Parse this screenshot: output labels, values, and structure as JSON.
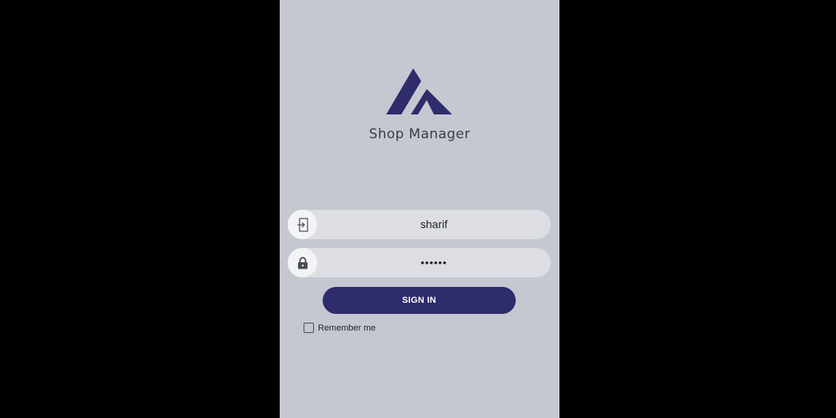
{
  "app": {
    "title": "Shop Manager",
    "logo_icon": "mountain-logo-icon",
    "brand_color": "#2e2c6b",
    "background_color": "#c5c8d1"
  },
  "login": {
    "username_icon": "login-enter-icon",
    "username_value": "sharif",
    "password_icon": "lock-icon",
    "password_value": "••••••",
    "sign_in_label": "SIGN IN",
    "remember_label": "Remember me",
    "remember_checked": false
  }
}
